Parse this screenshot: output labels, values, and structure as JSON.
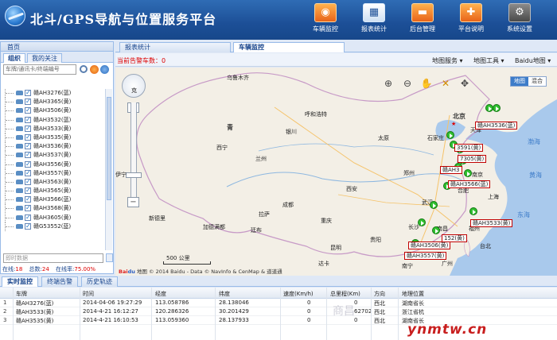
{
  "header": {
    "title": "北斗/GPS导航与位置服务平台",
    "nav": [
      {
        "label": "车辆监控",
        "icon": "vehicle-monitor-icon",
        "glyph": "◉",
        "active": true
      },
      {
        "label": "报表统计",
        "icon": "chart-icon",
        "glyph": "▦",
        "active": false
      },
      {
        "label": "后台管理",
        "icon": "truck-icon",
        "glyph": "▬",
        "active": false
      },
      {
        "label": "平台说明",
        "icon": "help-icon",
        "glyph": "✚",
        "active": false
      },
      {
        "label": "系统设置",
        "icon": "gear-icon",
        "glyph": "⚙",
        "active": false
      }
    ]
  },
  "left": {
    "home_tab": "首页",
    "tabs": [
      "组织",
      "我的关注"
    ],
    "search_placeholder": "车牌/通讯卡/终端编号",
    "vehicles": [
      "赣AH3276(蓝)",
      "赣AH3365(黄)",
      "赣AH3506(黄)",
      "赣AH3532(蓝)",
      "赣AH3533(黄)",
      "赣AH3535(黄)",
      "赣AH3536(黄)",
      "赣AH3537(黄)",
      "赣AH3556(黄)",
      "赣AH3557(黄)",
      "赣AH3563(黄)",
      "赣AH3565(黄)",
      "赣AH3566(蓝)",
      "赣AH3568(黄)",
      "赣AH3605(黄)",
      "赣G53552(蓝)"
    ],
    "instant_placeholder": "即时数据",
    "stats": {
      "online_label": "在线:",
      "online": "18",
      "total_label": "总数:",
      "total": "24",
      "rate_label": "在线率:",
      "rate": "75.00%"
    }
  },
  "center_tabs": [
    "报表统计",
    "车辆监控"
  ],
  "map": {
    "alarm_label": "当前告警车数：",
    "alarm_count": "0",
    "toolbar": [
      "地图服务 ▾",
      "地图工具 ▾",
      "Baidu地图 ▾"
    ],
    "map_types": [
      "地图",
      "混合"
    ],
    "scale": "500 公里",
    "copyright_prefix": "Bai",
    "copyright_brand": "du",
    "copyright_text": "地图 © 2014 Baidu - Data © NavInfo & CenMap & 道道通",
    "labels": [
      {
        "text": "乌鲁木齐",
        "kind": "city"
      },
      {
        "text": "克",
        "kind": "city"
      },
      {
        "text": "伊宁",
        "kind": "city"
      },
      {
        "text": "青",
        "kind": "big"
      },
      {
        "text": "西宁",
        "kind": "city"
      },
      {
        "text": "兰州",
        "kind": "city"
      },
      {
        "text": "银川",
        "kind": "city"
      },
      {
        "text": "呼和浩特",
        "kind": "city"
      },
      {
        "text": "北京",
        "kind": "big"
      },
      {
        "text": "天津",
        "kind": "city"
      },
      {
        "text": "石家庄",
        "kind": "city"
      },
      {
        "text": "太原",
        "kind": "city"
      },
      {
        "text": "渤海",
        "kind": "sea"
      },
      {
        "text": "黄海",
        "kind": "sea"
      },
      {
        "text": "东海",
        "kind": "sea"
      },
      {
        "text": "上海",
        "kind": "city"
      },
      {
        "text": "南京",
        "kind": "city"
      },
      {
        "text": "合肥",
        "kind": "city"
      },
      {
        "text": "郑州",
        "kind": "city"
      },
      {
        "text": "西安",
        "kind": "city"
      },
      {
        "text": "成都",
        "kind": "city"
      },
      {
        "text": "重庆",
        "kind": "city"
      },
      {
        "text": "拉萨",
        "kind": "city"
      },
      {
        "text": "新德里",
        "kind": "city"
      },
      {
        "text": "加德满都",
        "kind": "city"
      },
      {
        "text": "廷布",
        "kind": "city"
      },
      {
        "text": "昆明",
        "kind": "city"
      },
      {
        "text": "贵阳",
        "kind": "city"
      },
      {
        "text": "南宁",
        "kind": "city"
      },
      {
        "text": "广州",
        "kind": "city"
      },
      {
        "text": "达卡",
        "kind": "city"
      },
      {
        "text": "台北",
        "kind": "city"
      },
      {
        "text": "长沙",
        "kind": "city"
      },
      {
        "text": "南昌",
        "kind": "city"
      },
      {
        "text": "福州",
        "kind": "city"
      },
      {
        "text": "武汉",
        "kind": "city"
      }
    ],
    "vehicle_tags": [
      "赣AH3536(蓝)",
      "3591(黄)",
      "7305(黄)",
      "赣AH3566(蓝)",
      "赣AH3",
      "赣AH3533(黄)",
      "152(黄)",
      "赣AH3506(黄)",
      "赣AH3557(黄)"
    ]
  },
  "bottom": {
    "tabs": [
      "实时监控",
      "终端告警",
      "历史轨迹"
    ],
    "columns": [
      "车牌",
      "时间",
      "经度",
      "纬度",
      "速度(Km/h)",
      "总里程(Km)",
      "方向",
      "地理位置"
    ],
    "rows": [
      {
        "n": "1",
        "plate": "赣AH3276(蓝)",
        "time": "2014-04-06 19:27:29",
        "lng": "113.058786",
        "lat": "28.138046",
        "speed": "0",
        "mileage": "0",
        "dir": "西北",
        "loc": "湖南省长"
      },
      {
        "n": "2",
        "plate": "赣AH3533(黄)",
        "time": "2014-4-21 16:12:27",
        "lng": "120.286326",
        "lat": "30.201429",
        "speed": "0",
        "mileage": "62702",
        "dir": "西北",
        "loc": "浙江省杭"
      },
      {
        "n": "3",
        "plate": "赣AH3535(黄)",
        "time": "2014-4-21 16:10:53",
        "lng": "113.059360",
        "lat": "28.137933",
        "speed": "0",
        "mileage": "0",
        "dir": "西北",
        "loc": "湖南省长"
      }
    ]
  },
  "watermarks": [
    "商昌",
    "ynmtw.cn"
  ],
  "colors": {
    "header": "#1c4f97",
    "accent": "#15428b",
    "alarm": "#dd0000",
    "vehicle_marker": "#2fbf2f"
  }
}
